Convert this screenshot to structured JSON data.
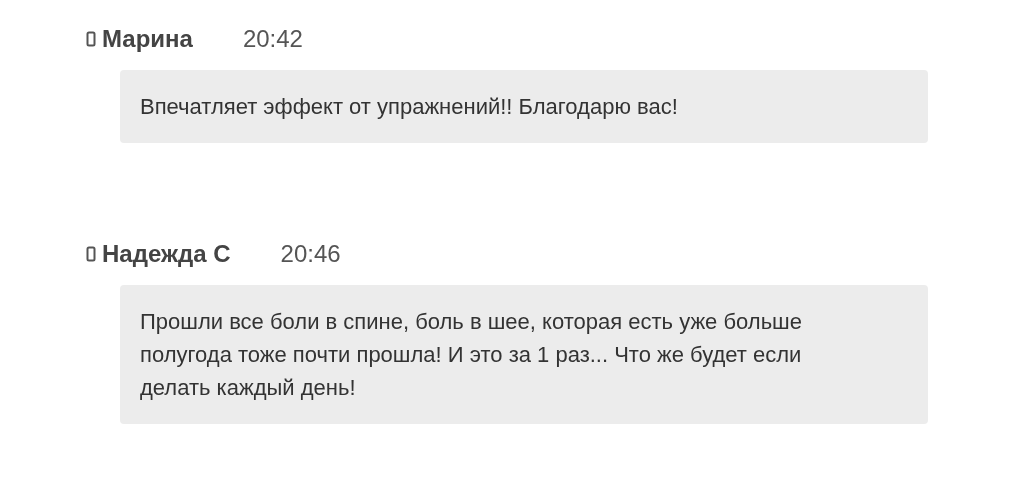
{
  "messages": [
    {
      "author": "Марина",
      "time": "20:42",
      "text": "Впечатляет эффект от упражнений!! Благодарю вас!"
    },
    {
      "author": "Надежда С",
      "time": "20:46",
      "text": "Прошли все боли в спине, боль в шее, которая есть уже больше полугода тоже почти прошла! И это за 1 раз... Что же будет если делать каждый день!"
    }
  ]
}
